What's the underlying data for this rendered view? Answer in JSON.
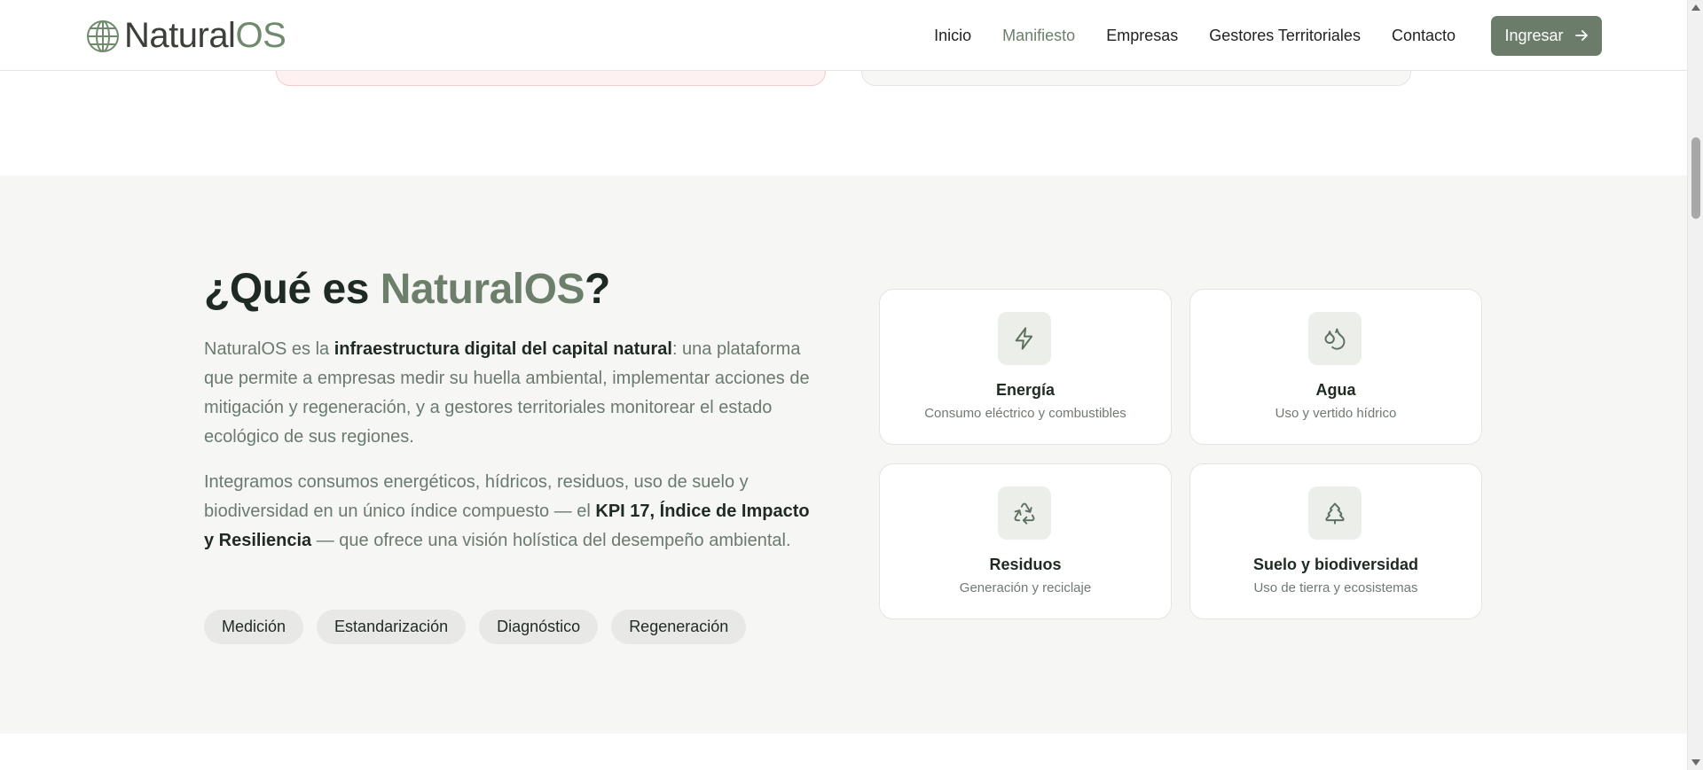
{
  "brand": {
    "name_prefix": "Natural",
    "name_suffix": "OS"
  },
  "nav": {
    "items": [
      {
        "label": "Inicio"
      },
      {
        "label": "Manifiesto",
        "active": true
      },
      {
        "label": "Empresas"
      },
      {
        "label": "Gestores Territoriales"
      },
      {
        "label": "Contacto"
      }
    ],
    "cta_label": "Ingresar"
  },
  "section": {
    "title_prefix": "¿Qué es ",
    "title_accent": "NaturalOS",
    "title_suffix": "?",
    "para1": {
      "a": "NaturalOS es la ",
      "b": "infraestructura digital del capital natural",
      "c": ": una plataforma que permite a empresas medir su huella ambiental, implementar acciones de mitigación y regeneración, y a gestores territoriales monitorear el estado ecológico de sus regiones."
    },
    "para2": {
      "a": "Integramos consumos energéticos, hídricos, residuos, uso de suelo y biodiversidad en un único índice compuesto — el ",
      "b": "KPI 17, Índice de Impacto y Resiliencia",
      "c": " — que ofrece una visión holística del desempeño ambiental."
    },
    "tags": [
      "Medición",
      "Estandarización",
      "Diagnóstico",
      "Regeneración"
    ],
    "cards": [
      {
        "title": "Energía",
        "subtitle": "Consumo eléctrico y combustibles",
        "icon": "lightning-icon"
      },
      {
        "title": "Agua",
        "subtitle": "Uso y vertido hídrico",
        "icon": "droplets-icon"
      },
      {
        "title": "Residuos",
        "subtitle": "Generación y reciclaje",
        "icon": "recycle-icon"
      },
      {
        "title": "Suelo y biodiversidad",
        "subtitle": "Uso de tierra y ecosistemas",
        "icon": "tree-icon"
      }
    ]
  },
  "colors": {
    "accent": "#6b7f6b",
    "section_bg": "#f6f6f5",
    "button_bg": "#6b7d6a"
  }
}
